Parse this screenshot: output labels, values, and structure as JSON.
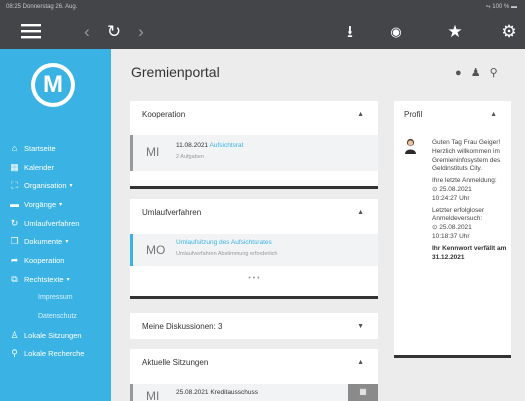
{
  "status": {
    "time_date": "08:25  Donnerstag 26. Aug.",
    "battery": "⭇ 100 % ▬"
  },
  "logo": {
    "letter": "M"
  },
  "sidebar": {
    "items": [
      {
        "label": "Startseite",
        "icon": "home-icon"
      },
      {
        "label": "Kalender",
        "icon": "calendar-icon"
      },
      {
        "label": "Organisation",
        "icon": "org-icon"
      },
      {
        "label": "Vorgänge",
        "icon": "folder-icon"
      },
      {
        "label": "Umlaufverfahren",
        "icon": "refresh-icon"
      },
      {
        "label": "Dokumente",
        "icon": "documents-icon"
      },
      {
        "label": "Kooperation",
        "icon": "share-icon"
      },
      {
        "label": "Rechtstexte",
        "icon": "external-icon"
      },
      {
        "label": "Impressum"
      },
      {
        "label": "Datenschutz"
      },
      {
        "label": "Lokale Sitzungen",
        "icon": "user-icon"
      },
      {
        "label": "Lokale Recherche",
        "icon": "search-icon"
      }
    ]
  },
  "page": {
    "title": "Gremienportal"
  },
  "kooperation": {
    "title": "Kooperation",
    "entry": {
      "weekday": "MI",
      "date": "11.08.2021",
      "link": "Aufsichtsrat",
      "sub": "2 Aufgaben"
    }
  },
  "umlauf": {
    "title": "Umlaufverfahren",
    "entry": {
      "weekday": "MO",
      "link": "Umlaufsitzung des Aufsichtsrates",
      "sub": "Umlaufverfahren Abstimmung erforderlich"
    },
    "more": "• • •"
  },
  "diskussionen": {
    "title": "Meine Diskussionen: 3"
  },
  "sitzungen": {
    "title": "Aktuelle Sitzungen",
    "entry": {
      "weekday": "MI",
      "text": "25.08.2021 Kreditausschuss"
    }
  },
  "profil": {
    "title": "Profil",
    "greeting": "Guten Tag Frau Geiger! Herzlich willkommen im Gremieninfosystem des Geldinstituts City.",
    "last_login_label": "Ihre letzte Anmeldung:",
    "last_login_date": "⊙ 25.08.2021",
    "last_login_time": "10:24:27 Uhr",
    "last_fail_label": "Letzter erfolgloser Anmeldeversuch:",
    "last_fail_date": "⊙ 25.08.2021",
    "last_fail_time": "10:18:37 Uhr",
    "expiry": "Ihr Kennwort verfällt am 31.12.2021"
  }
}
